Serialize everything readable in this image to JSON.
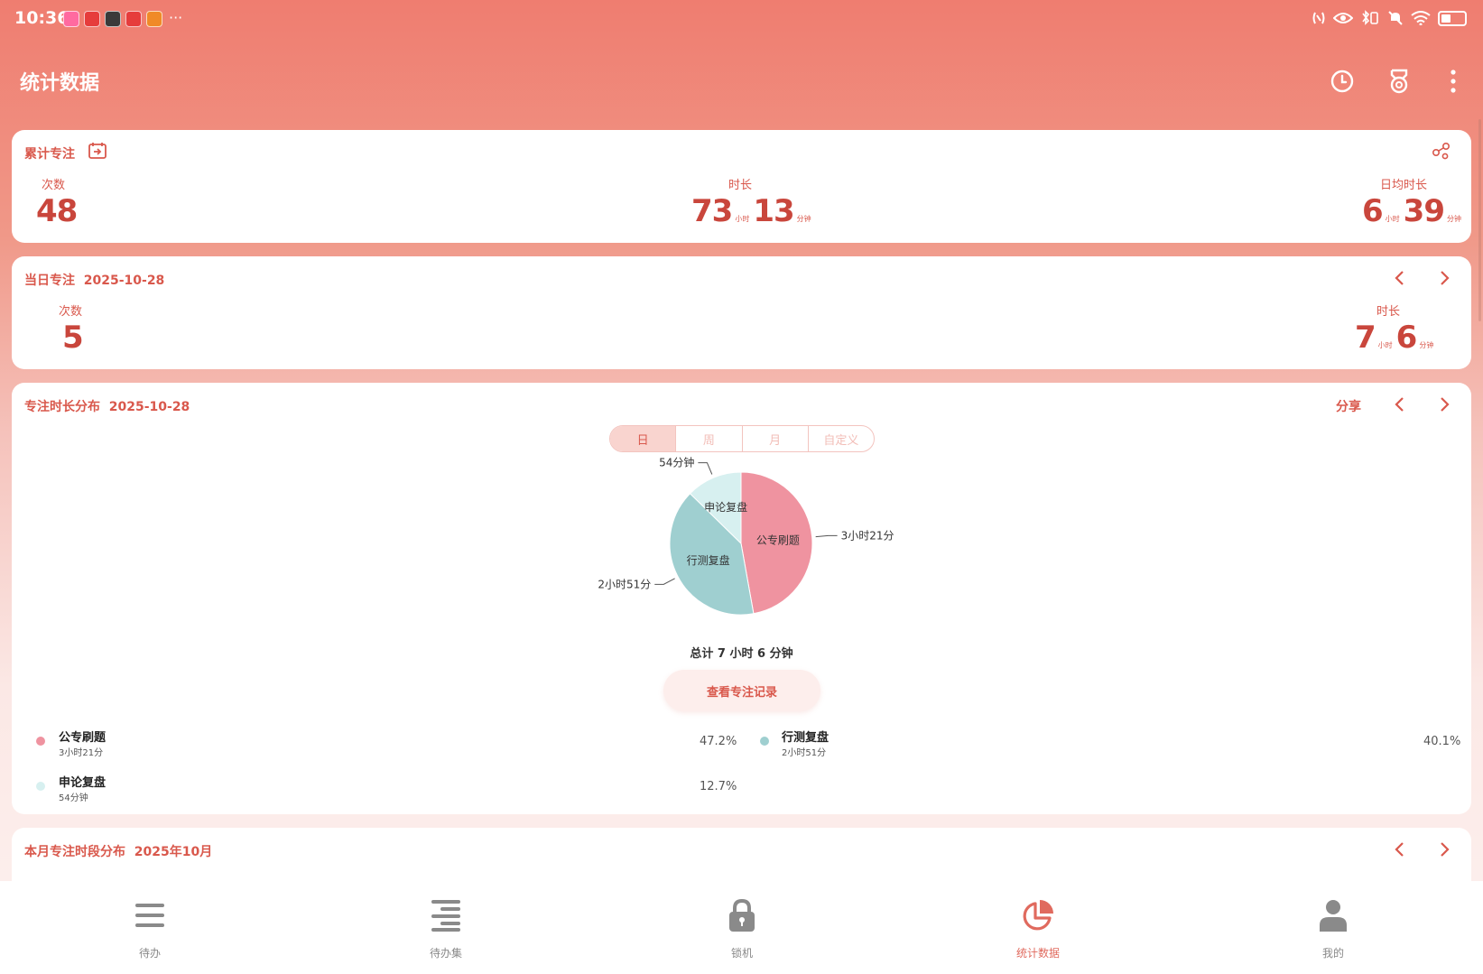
{
  "status_bar": {
    "time": "10:36",
    "more": "···"
  },
  "app_bar": {
    "title": "统计数据"
  },
  "cumulative": {
    "title": "累计专注",
    "count_label": "次数",
    "count": "48",
    "duration_label": "时长",
    "hours": "73",
    "hours_unit": "小时",
    "minutes": "13",
    "minutes_unit": "分钟",
    "daily_avg_label": "日均时长",
    "avg_hours": "6",
    "avg_hours_unit": "小时",
    "avg_minutes": "39",
    "avg_minutes_unit": "分钟"
  },
  "daily": {
    "title": "当日专注",
    "date": "2025-10-28",
    "count_label": "次数",
    "count": "5",
    "duration_label": "时长",
    "hours": "7",
    "hours_unit": "小时",
    "minutes": "6",
    "minutes_unit": "分钟"
  },
  "distribution": {
    "title": "专注时长分布",
    "date": "2025-10-28",
    "share_label": "分享",
    "tabs": [
      {
        "label": "日",
        "active": true
      },
      {
        "label": "周",
        "active": false
      },
      {
        "label": "月",
        "active": false
      },
      {
        "label": "自定义",
        "active": false
      }
    ],
    "total_text": "总计 7 小时 6 分钟",
    "view_records_label": "查看专注记录",
    "legend": [
      {
        "name": "公专刷题",
        "duration": "3小时21分",
        "percent": "47.2%"
      },
      {
        "name": "行测复盘",
        "duration": "2小时51分",
        "percent": "40.1%"
      },
      {
        "name": "申论复盘",
        "duration": "54分钟",
        "percent": "12.7%"
      }
    ]
  },
  "monthly": {
    "title": "本月专注时段分布",
    "month": "2025年10月"
  },
  "chart_data": {
    "type": "pie",
    "categories": [
      "公专刷题",
      "行测复盘",
      "申论复盘"
    ],
    "values": [
      201,
      171,
      54
    ],
    "value_labels": [
      "3小时21分",
      "2小时51分",
      "54分钟"
    ],
    "percentages": [
      47.2,
      40.1,
      12.7
    ],
    "colors": [
      "#ef93a0",
      "#9fcfd0",
      "#d7f0f0"
    ]
  },
  "bottom_nav": [
    {
      "label": "待办",
      "icon": "todo-list-icon",
      "active": false
    },
    {
      "label": "待办集",
      "icon": "todo-collection-icon",
      "active": false
    },
    {
      "label": "锁机",
      "icon": "lock-icon",
      "active": false
    },
    {
      "label": "统计数据",
      "icon": "pie-chart-icon",
      "active": true
    },
    {
      "label": "我的",
      "icon": "person-icon",
      "active": false
    }
  ],
  "colors": {
    "accent": "#d9584c",
    "header": "#ef7d70"
  }
}
